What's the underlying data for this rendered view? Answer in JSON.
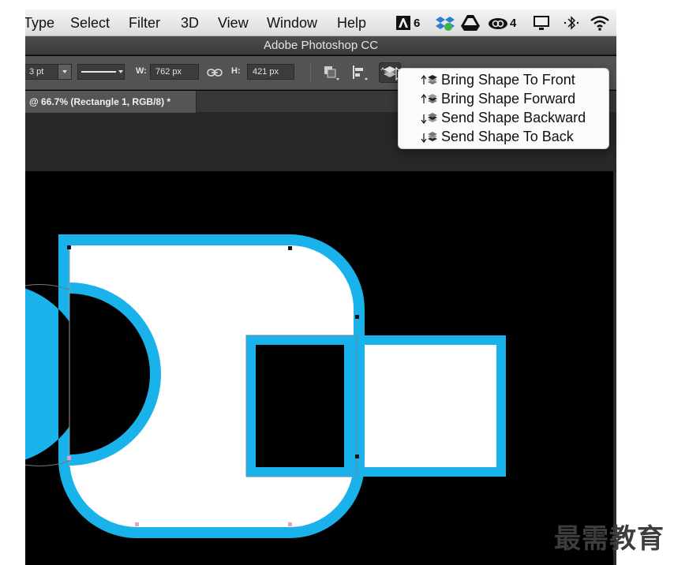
{
  "menu": {
    "items": [
      "Type",
      "Select",
      "Filter",
      "3D",
      "View",
      "Window",
      "Help"
    ]
  },
  "status": {
    "adobe_count": "6",
    "cc_count": "4"
  },
  "window": {
    "title": "Adobe Photoshop CC"
  },
  "options": {
    "stroke_width": "3 pt",
    "width_label": "W:",
    "width_value": "762 px",
    "height_label": "H:",
    "height_value": "421 px"
  },
  "document": {
    "tab_label": "@ 66.7% (Rectangle 1, RGB/8) *"
  },
  "arrange_menu": {
    "items": [
      {
        "label": "Bring Shape To Front",
        "icon": "bring-to-front-icon"
      },
      {
        "label": "Bring Shape Forward",
        "icon": "bring-forward-icon"
      },
      {
        "label": "Send Shape Backward",
        "icon": "send-backward-icon"
      },
      {
        "label": "Send Shape To Back",
        "icon": "send-to-back-icon"
      }
    ]
  },
  "watermark": "最需教育",
  "colors": {
    "shape_fill": "#ffffff",
    "shape_stroke": "#1ab2ea",
    "canvas": "#000000",
    "anchor_point": "#e8a0c0"
  }
}
